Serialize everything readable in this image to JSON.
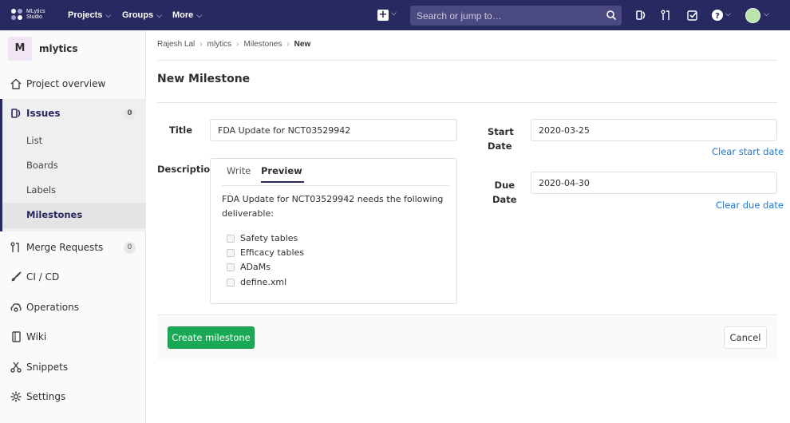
{
  "navbar": {
    "logo_line1": "MLytics",
    "logo_line2": "Studio",
    "menus": [
      "Projects",
      "Groups",
      "More"
    ],
    "search_placeholder": "Search or jump to…"
  },
  "sidebar": {
    "project_initial": "M",
    "project_name": "mlytics",
    "items": [
      {
        "label": "Project overview",
        "icon": "home-icon"
      },
      {
        "label": "Issues",
        "icon": "issues-icon",
        "count": "0"
      },
      {
        "label": "Merge Requests",
        "icon": "merge-request-icon",
        "count": "0"
      },
      {
        "label": "CI / CD",
        "icon": "rocket-icon"
      },
      {
        "label": "Operations",
        "icon": "cloud-gear-icon"
      },
      {
        "label": "Wiki",
        "icon": "book-icon"
      },
      {
        "label": "Snippets",
        "icon": "scissors-icon"
      },
      {
        "label": "Settings",
        "icon": "gear-icon"
      }
    ],
    "issues_sub": [
      "List",
      "Boards",
      "Labels",
      "Milestones"
    ]
  },
  "breadcrumb": [
    "Rajesh Lal",
    "mlytics",
    "Milestones",
    "New"
  ],
  "page_title": "New Milestone",
  "form": {
    "title_label": "Title",
    "title_value": "FDA Update for NCT03529942",
    "description_label": "Description",
    "tab_write": "Write",
    "tab_preview": "Preview",
    "description_text": "FDA Update for NCT03529942 needs the following deliverable:",
    "tasks": [
      "Safety tables",
      "Efficacy tables",
      "ADaMs",
      "define.xml"
    ],
    "start_label_1": "Start",
    "start_label_2": "Date",
    "start_value": "2020-03-25",
    "clear_start": "Clear start date",
    "due_label_1": "Due",
    "due_label_2": "Date",
    "due_value": "2020-04-30",
    "clear_due": "Clear due date"
  },
  "buttons": {
    "create": "Create milestone",
    "cancel": "Cancel"
  },
  "colors": {
    "navbar": "#292961",
    "accent": "#1aaa55",
    "link": "#1f78d1"
  }
}
